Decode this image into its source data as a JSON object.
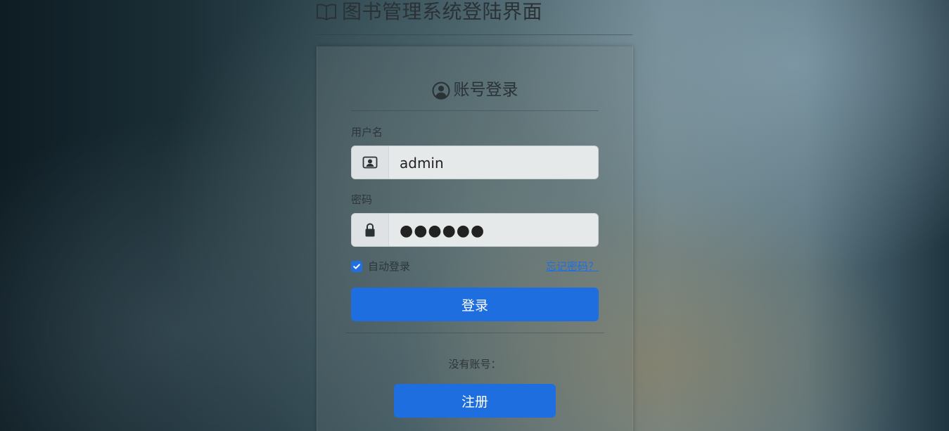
{
  "header": {
    "title": "图书管理系统登陆界面",
    "icon": "book-icon"
  },
  "login_form": {
    "heading": "账号登录",
    "heading_icon": "user-circle-icon",
    "username": {
      "label": "用户名",
      "value": "admin",
      "icon": "id-card-icon"
    },
    "password": {
      "label": "密码",
      "value": "●●●●●●",
      "icon": "lock-icon"
    },
    "remember": {
      "label": "自动登录",
      "checked": true
    },
    "forgot_link": "忘记密码？",
    "submit_label": "登录"
  },
  "register": {
    "prompt": "没有账号：",
    "button_label": "注册"
  },
  "colors": {
    "primary": "#1f6ee0",
    "link": "#1e6fe0",
    "text": "#2a3236"
  }
}
